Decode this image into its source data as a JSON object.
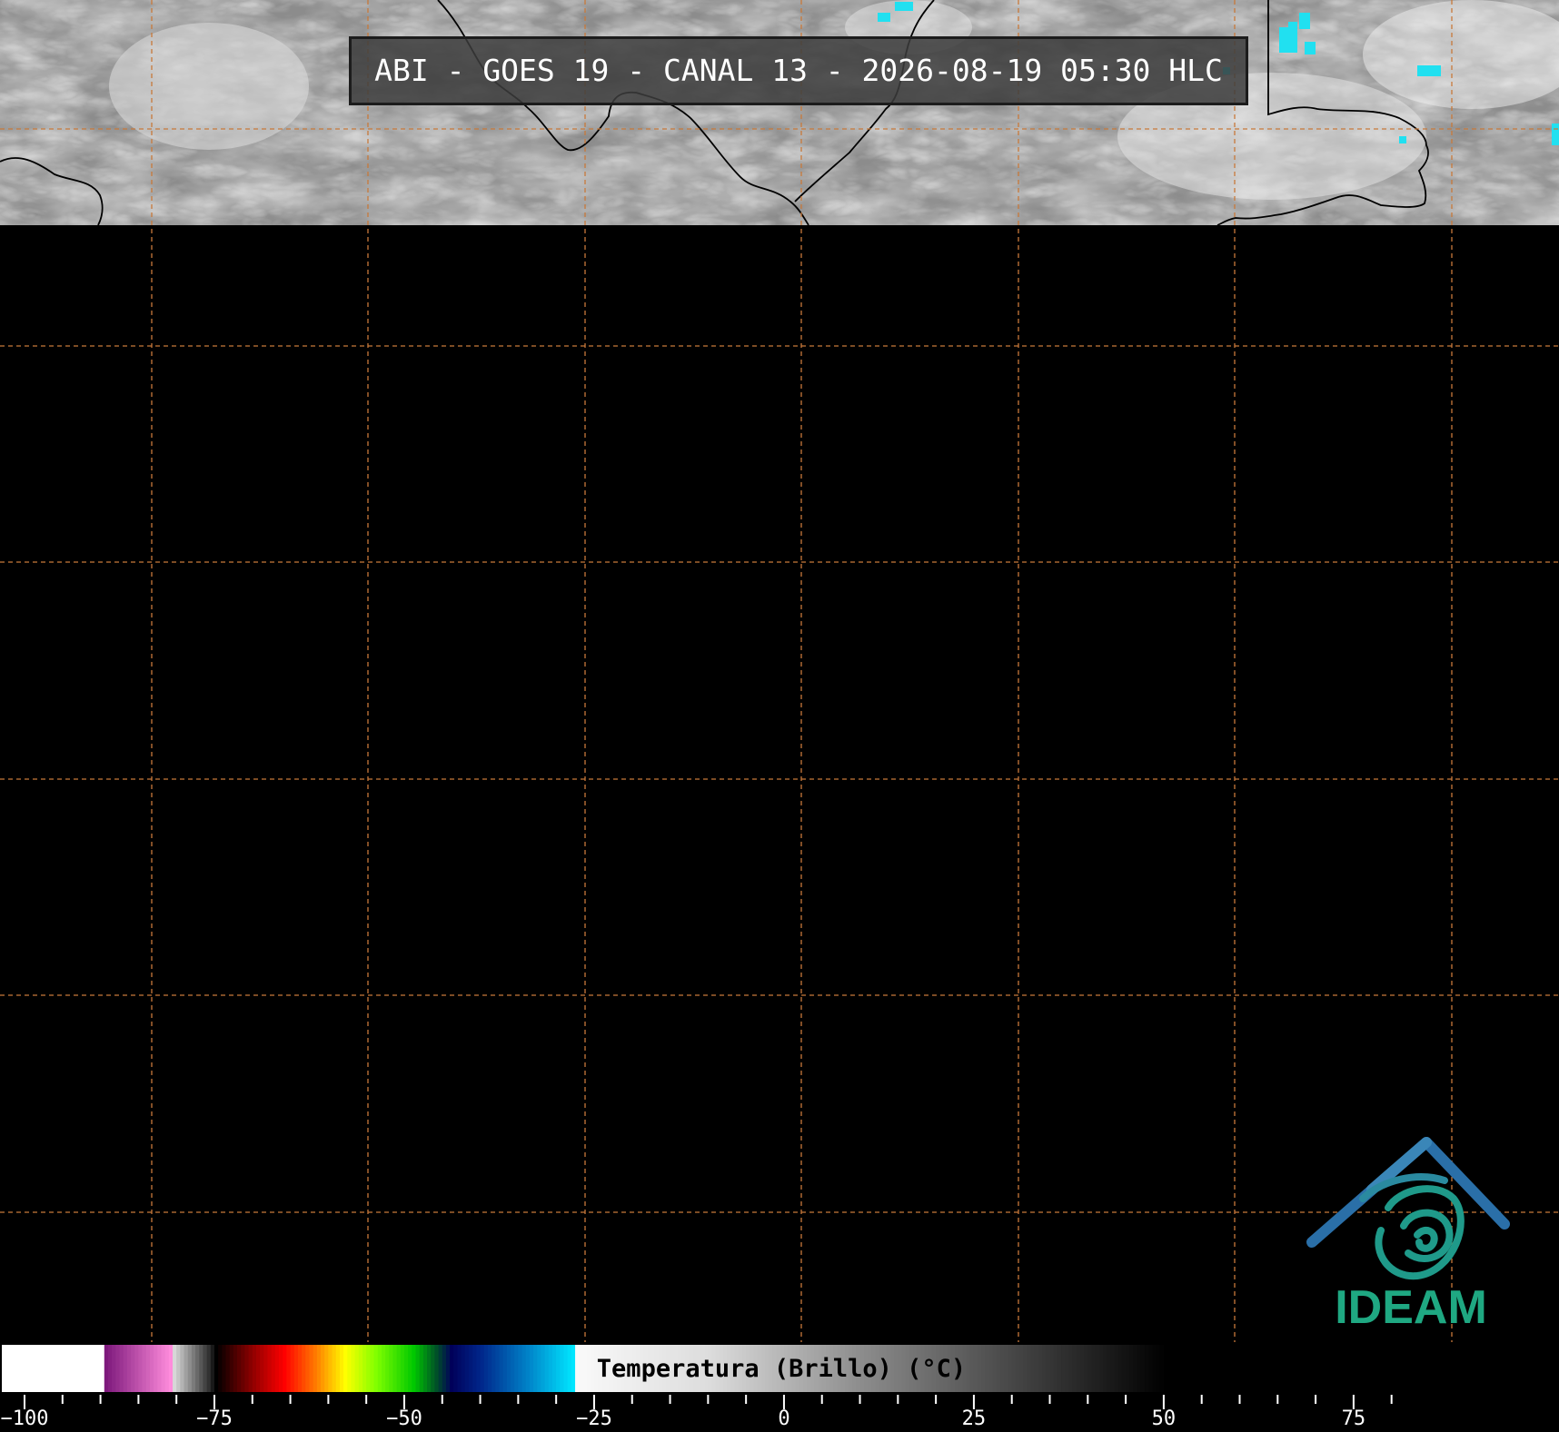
{
  "title": "ABI - GOES 19 - CANAL 13 - 2026-08-19 05:30 HLC",
  "colorbar": {
    "label": "Temperatura (Brillo) (°C)",
    "min": -105,
    "max": 82,
    "major_ticks": [
      -100,
      -75,
      -50,
      -25,
      0,
      25,
      50,
      75
    ],
    "tick_labels": [
      "−100",
      "−75",
      "−50",
      "−25",
      "0",
      "25",
      "50",
      "75"
    ],
    "minor_step": 5
  },
  "logo": {
    "text": "IDEAM",
    "colors": {
      "roof": "#2a5fa8",
      "swirl": "#1f9a8a",
      "text": "#1fa882"
    }
  },
  "colors": {
    "grid": "#c8793a",
    "border": "#000000",
    "no_data": "#000000"
  }
}
